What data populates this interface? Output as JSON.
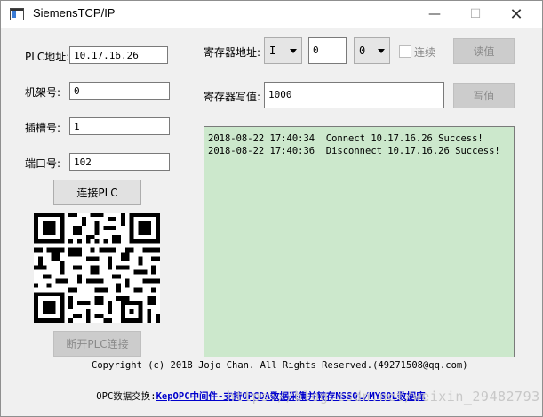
{
  "window": {
    "title": "SiemensTCP/IP",
    "minimize_glyph": "—",
    "maximize_glyph": "☐",
    "close_glyph": "✕"
  },
  "left": {
    "plc_address_label": "PLC地址:",
    "plc_address_value": "10.17.16.26",
    "rack_label": "机架号:",
    "rack_value": "0",
    "slot_label": "插槽号:",
    "slot_value": "1",
    "port_label": "端口号:",
    "port_value": "102",
    "connect_button": "连接PLC",
    "disconnect_button": "断开PLC连接"
  },
  "register": {
    "address_label": "寄存器地址:",
    "area_value": "I",
    "offset_value": "0",
    "bit_value": "0",
    "continuous_label": "连续",
    "read_button": "读值",
    "write_label": "寄存器写值:",
    "write_value": "1000",
    "write_button": "写值"
  },
  "log": {
    "lines": [
      "2018-08-22 17:40:34  Connect 10.17.16.26 Success!",
      "2018-08-22 17:40:36  Disconnect 10.17.16.26 Success!"
    ]
  },
  "footer": {
    "copyright": "Copyright (c) 2018 Jojo Chan. All Rights Reserved.(49271508@qq.com)",
    "opc_label": "OPC数据交换:",
    "opc_link": "KepOPC中间件-支持OPCDA数据采集并转存MSSQL/MYSQL数据库"
  },
  "watermark": "https://blog.csdn.net/weixin_29482793",
  "icons": {
    "app": "window-app-icon",
    "qr": "qr-code-icon"
  }
}
